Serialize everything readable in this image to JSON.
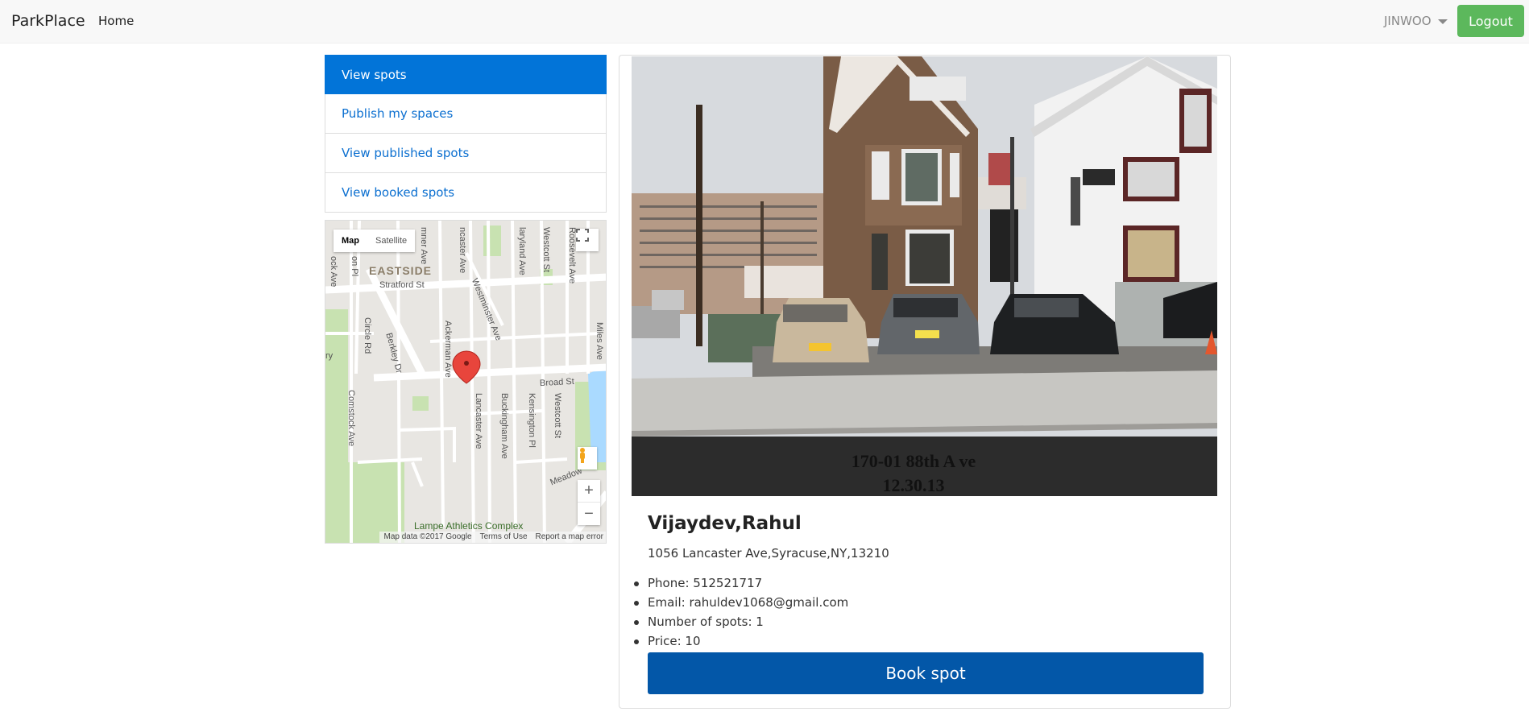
{
  "navbar": {
    "brand": "ParkPlace",
    "home": "Home",
    "user": "JINWOO",
    "logout": "Logout"
  },
  "sidebar": {
    "items": [
      {
        "label": "View spots",
        "active": true
      },
      {
        "label": "Publish my spaces",
        "active": false
      },
      {
        "label": "View published spots",
        "active": false
      },
      {
        "label": "View booked spots",
        "active": false
      }
    ]
  },
  "map": {
    "type_map": "Map",
    "type_satellite": "Satellite",
    "labels": {
      "eastside": "EASTSIDE",
      "stratford": "Stratford St",
      "broad": "Broad St",
      "westminster": "Westminster Ave",
      "circle": "Circle Rd",
      "berkley": "Berkley Dr",
      "ackerman": "Ackerman Ave",
      "lancaster": "Lancaster Ave",
      "buckingham": "Buckingham Ave",
      "kensington": "Kensington Pl",
      "westcott": "Westcott St",
      "westcott2": "Westcott St",
      "comstock": "Comstock Ave",
      "miles": "Miles Ave",
      "roosevelt": "Roosevelt Ave",
      "maryland": "laryland Ave",
      "lancaster2": "ncaster Ave",
      "sumner": "mner Ave",
      "meadow": "Meadow",
      "lampe": "Lampe Athletics Complex",
      "ry": "ry",
      "ock": "ock Ave",
      "on": "on Pl"
    },
    "footer": {
      "data": "Map data ©2017 Google",
      "terms": "Terms of Use",
      "report": "Report a map error"
    },
    "logo": "Google"
  },
  "spot": {
    "photo_caption_line1": "170-01 88th A ve",
    "photo_caption_line2": "12.30.13",
    "owner": "Vijaydev,Rahul",
    "address": "1056 Lancaster Ave,Syracuse,NY,13210",
    "details": [
      "Phone: 512521717",
      "Email: rahuldev1068@gmail.com",
      "Number of spots: 1",
      "Price: 10"
    ],
    "book_label": "Book spot"
  },
  "colors": {
    "active_blue": "#0274d8",
    "link_blue": "#0b6fd0",
    "logout_green": "#5cb85c",
    "book_blue": "#0357a8"
  }
}
